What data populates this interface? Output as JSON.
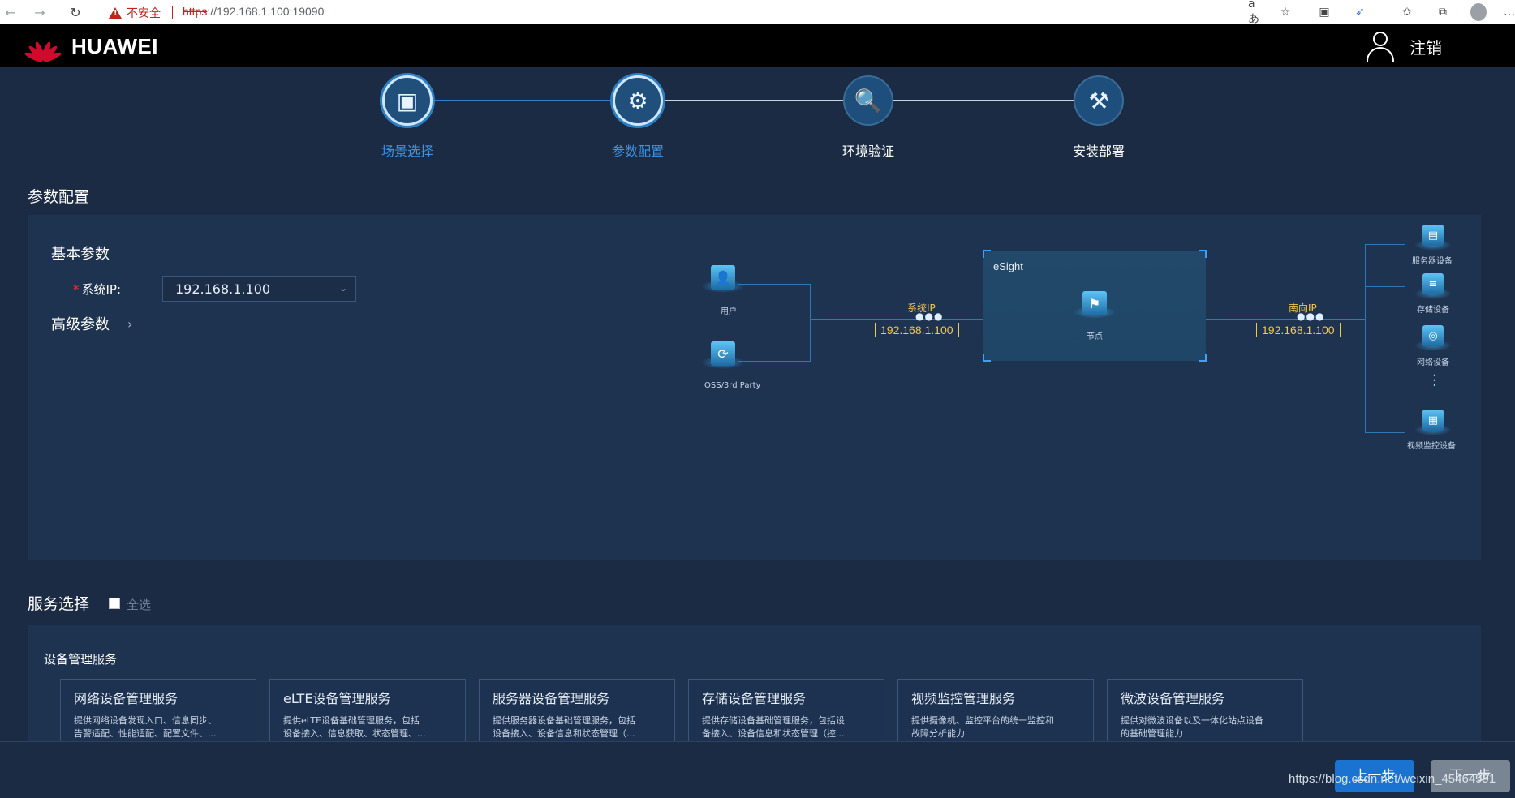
{
  "browser": {
    "security_label": "不安全",
    "url_protocol": "https",
    "url_rest": "://192.168.1.100:19090"
  },
  "header": {
    "brand": "HUAWEI",
    "logout": "注销"
  },
  "steps": [
    {
      "label": "场景选择",
      "state": "done",
      "icon": "scene-icon"
    },
    {
      "label": "参数配置",
      "state": "current",
      "icon": "gear-icon"
    },
    {
      "label": "环境验证",
      "state": "pending",
      "icon": "verify-icon"
    },
    {
      "label": "安装部署",
      "state": "pending",
      "icon": "deploy-icon"
    }
  ],
  "param_section": {
    "title": "参数配置",
    "basic_title": "基本参数",
    "ip_label": "系统IP:",
    "ip_value": "192.168.1.100",
    "advanced_title": "高级参数"
  },
  "topology": {
    "user_label": "用户",
    "oss_label": "OSS/3rd Party",
    "esight_label": "eSight",
    "node_label": "节点",
    "sys_ip_label": "系统IP",
    "sys_ip_value": "192.168.1.100",
    "south_ip_label": "南向IP",
    "south_ip_value": "192.168.1.100",
    "devices": [
      "服务器设备",
      "存储设备",
      "网络设备",
      "视频监控设备"
    ]
  },
  "service_section": {
    "title": "服务选择",
    "select_all": "全选",
    "category": "设备管理服务",
    "cards": [
      {
        "title": "网络设备管理服务",
        "desc1": "提供网络设备发现入口、信息同步、",
        "desc2": "告警适配、性能适配、配置文件、..."
      },
      {
        "title": "eLTE设备管理服务",
        "desc1": "提供eLTE设备基础管理服务，包括",
        "desc2": "设备接入、信息获取、状态管理、..."
      },
      {
        "title": "服务器设备管理服务",
        "desc1": "提供服务器设备基础管理服务，包括",
        "desc2": "设备接入、设备信息和状态管理（..."
      },
      {
        "title": "存储设备管理服务",
        "desc1": "提供存储设备基础管理服务，包括设",
        "desc2": "备接入、设备信息和状态管理（控..."
      },
      {
        "title": "视频监控管理服务",
        "desc1": "提供摄像机、监控平台的统一监控和",
        "desc2": "故障分析能力"
      },
      {
        "title": "微波设备管理服务",
        "desc1": "提供对微波设备以及一体化站点设备",
        "desc2": "的基础管理能力"
      }
    ]
  },
  "footer": {
    "prev": "上一步",
    "next": "下一步"
  },
  "watermark": "https://blog.csdn.net/weixin_45464991",
  "colors": {
    "accent": "#1a73d1",
    "active_step": "#3d94e6",
    "ip_tag": "#f2c94c",
    "brand_red": "#cf0a2c"
  }
}
